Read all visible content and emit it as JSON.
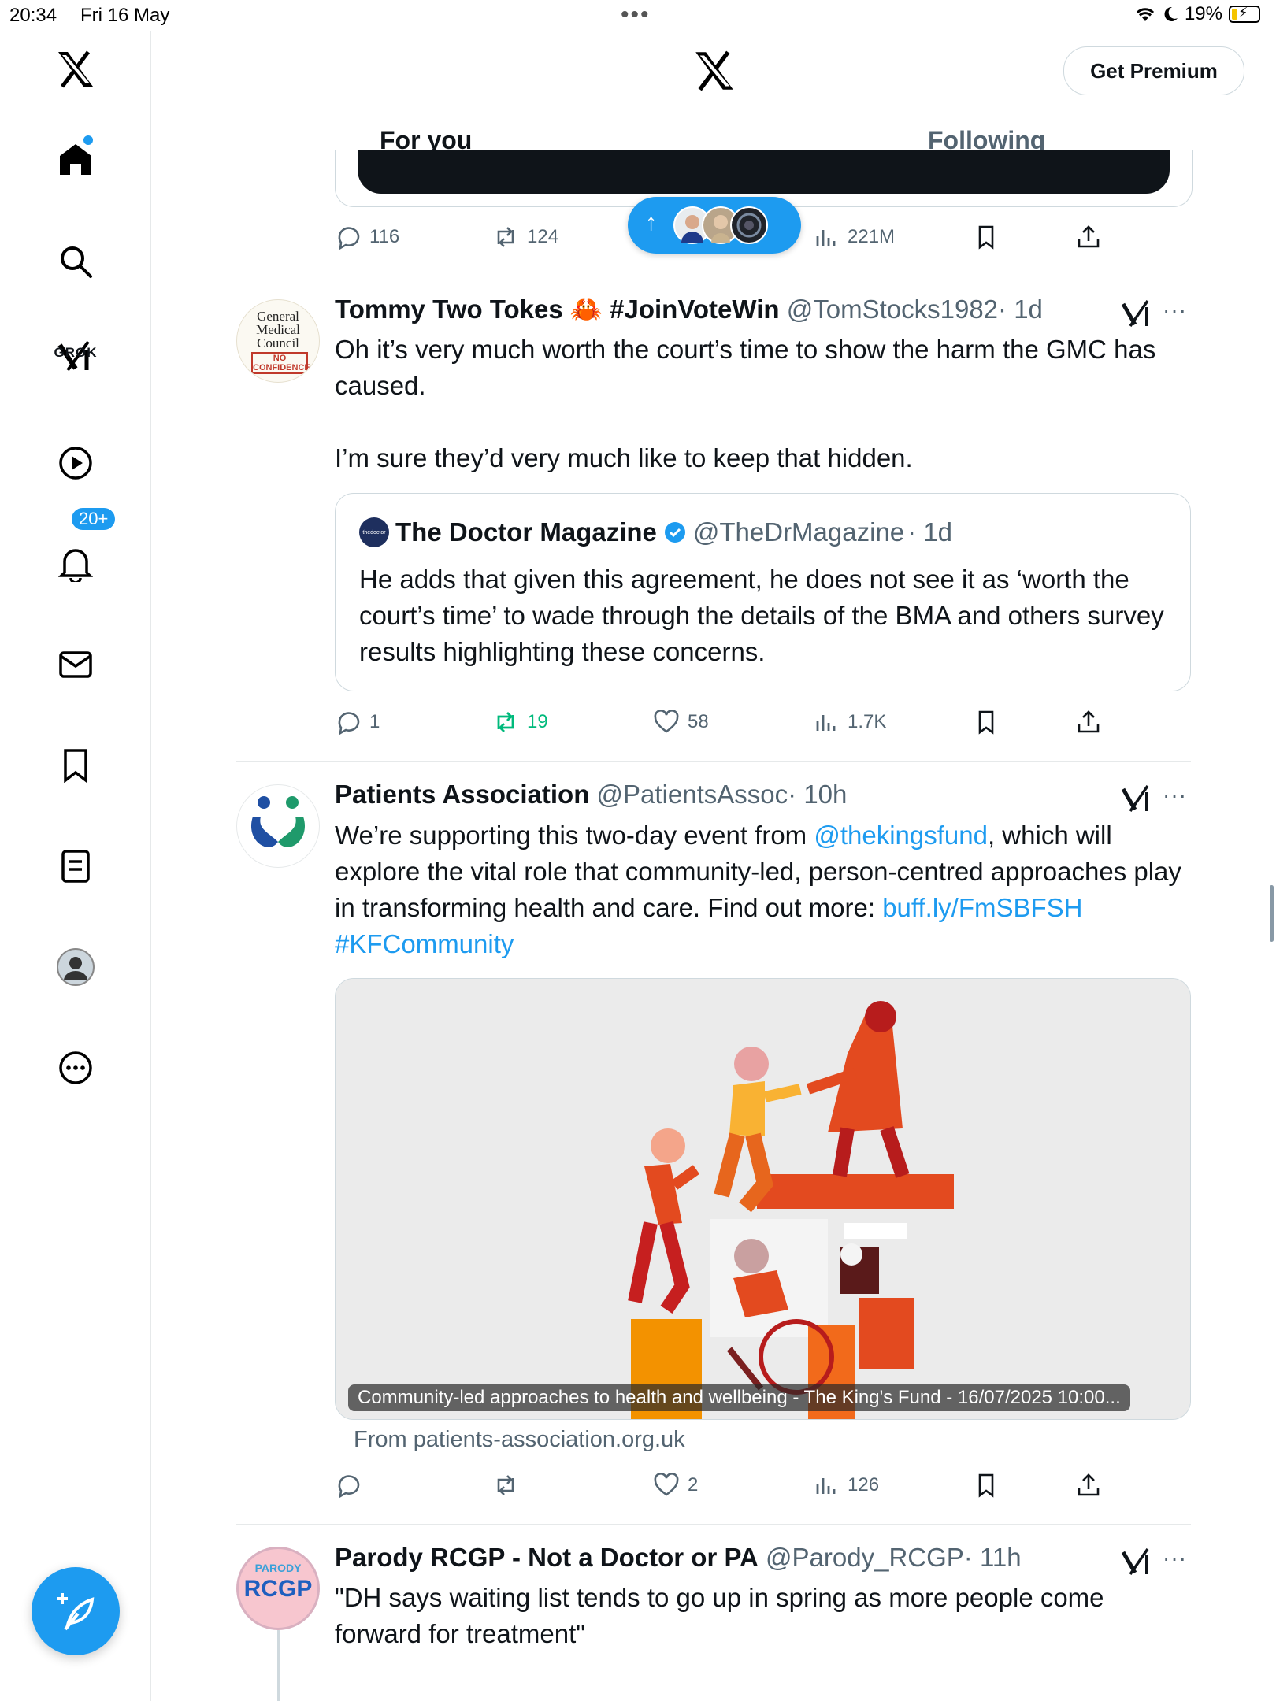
{
  "status_bar": {
    "time": "20:34",
    "date": "Fri 16 May",
    "battery": "19%"
  },
  "sidebar": {
    "grok_label": "GROK",
    "notifications_badge": "20+"
  },
  "header": {
    "premium_label": "Get Premium",
    "tabs": [
      {
        "label": "For you"
      },
      {
        "label": "Following"
      }
    ]
  },
  "tweets": [
    {
      "actions": {
        "replies": "116",
        "reposts": "124",
        "likes": "",
        "views": "221M"
      }
    },
    {
      "author": "Tommy Two Tokes 🦀 #JoinVoteWin",
      "handle": "@TomStocks1982",
      "time": "· 1d",
      "avatar_text": [
        "General",
        "Medical",
        "Council",
        "NO",
        "CONFIDENCE"
      ],
      "text": [
        "Oh it’s very much worth the court’s time to show the harm the GMC has caused.",
        "I’m sure they’d very much like to keep that hidden."
      ],
      "quote": {
        "author": "The Doctor Magazine",
        "handle": "@TheDrMagazine",
        "time": "· 1d",
        "avatar_text": "thedoctor",
        "text": "He adds that given this agreement, he does not see it as ‘worth the court’s time’ to wade through the details of the BMA and others survey results highlighting these concerns."
      },
      "actions": {
        "replies": "1",
        "reposts": "19",
        "likes": "58",
        "views": "1.7K"
      }
    },
    {
      "author": "Patients Association",
      "handle": "@PatientsAssoc",
      "time": "· 10h",
      "text_parts": {
        "a": "We’re supporting this two-day event from ",
        "mention": "@thekingsfund",
        "b": ", which will explore the vital role that community-led, person-centred approaches play in transforming health and care. Find out more: ",
        "url": "buff.ly/FmSBFSH",
        "hashtag": "#KFCommunity"
      },
      "card_caption": "Community-led approaches to health and wellbeing - The King's Fund - 16/07/2025 10:00...",
      "card_from": "From patients-association.org.uk",
      "actions": {
        "replies": "",
        "reposts": "",
        "likes": "2",
        "views": "126"
      }
    },
    {
      "author": "Parody RCGP - Not a Doctor or PA",
      "handle": "@Parody_RCGP",
      "time": "· 11h",
      "avatar_text": [
        "PARODY",
        "RCGP"
      ],
      "text": "\"DH says waiting list tends to go up in spring as more people come forward for treatment\""
    }
  ],
  "colors": {
    "accent": "#1d9bf0",
    "repost_active": "#00ba7c",
    "secondary_text": "#536471"
  }
}
